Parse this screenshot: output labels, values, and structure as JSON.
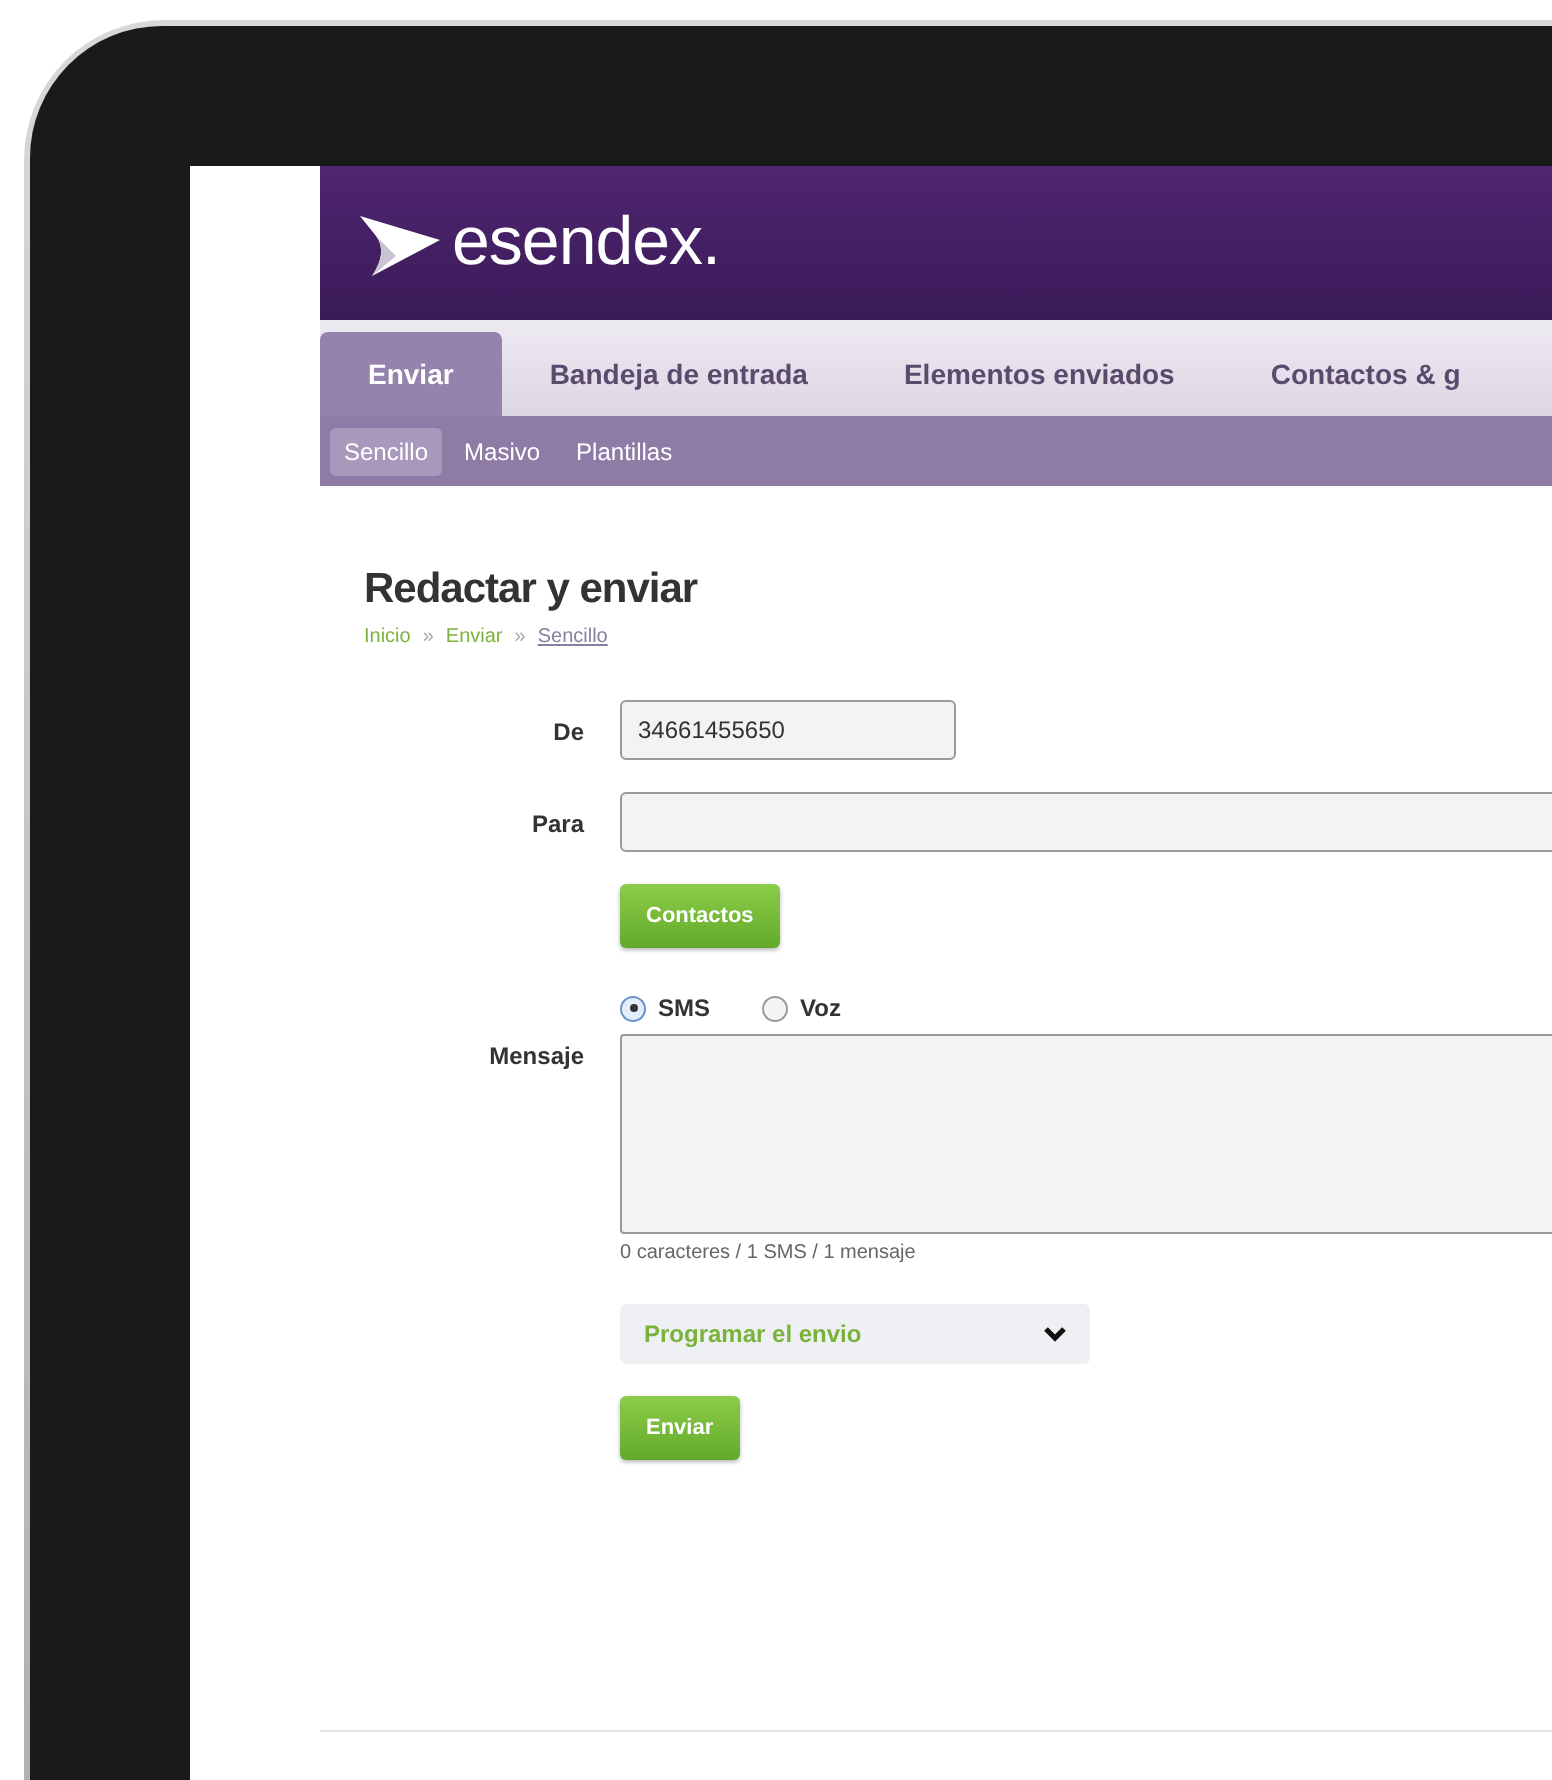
{
  "logo": {
    "text": "esendex."
  },
  "tabs": [
    {
      "label": "Enviar",
      "selected": true
    },
    {
      "label": "Bandeja de entrada",
      "selected": false
    },
    {
      "label": "Elementos enviados",
      "selected": false
    },
    {
      "label": "Contactos & g",
      "selected": false
    }
  ],
  "subtabs": [
    {
      "label": "Sencillo",
      "selected": true
    },
    {
      "label": "Masivo",
      "selected": false
    },
    {
      "label": "Plantillas",
      "selected": false
    }
  ],
  "page_title": "Redactar y enviar",
  "breadcrumb": [
    {
      "label": "Inicio",
      "current": false
    },
    {
      "label": "Enviar",
      "current": false
    },
    {
      "label": "Sencillo",
      "current": true
    }
  ],
  "breadcrumb_separator": "»",
  "form": {
    "from": {
      "label": "De",
      "value": "34661455650"
    },
    "to": {
      "label": "Para"
    },
    "contacts_button": "Contactos",
    "types": [
      {
        "label": "SMS",
        "selected": true
      },
      {
        "label": "Voz",
        "selected": false
      }
    ],
    "message": {
      "label": "Mensaje",
      "counter": "0 caracteres / 1 SMS / 1 mensaje"
    },
    "schedule": "Programar el envio",
    "send_button": "Enviar"
  }
}
